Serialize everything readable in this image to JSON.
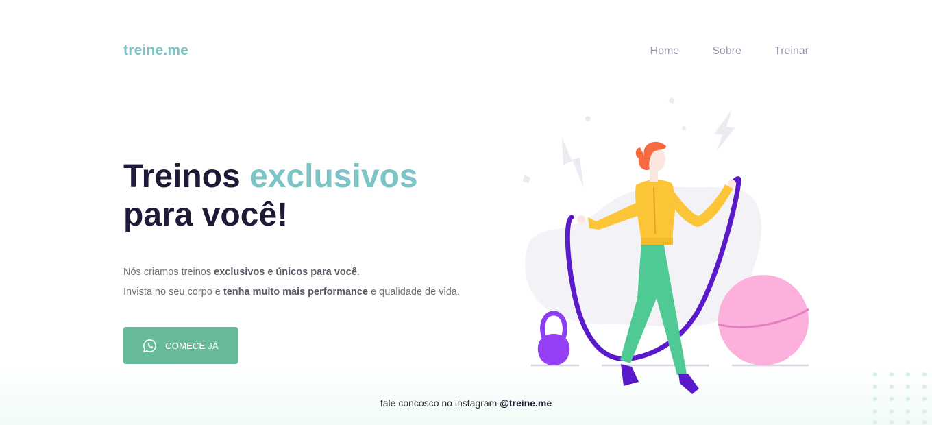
{
  "brand": {
    "logo": "treine.me"
  },
  "nav": {
    "items": [
      "Home",
      "Sobre",
      "Treinar"
    ]
  },
  "hero": {
    "title_part1": "Treinos",
    "title_accent": "exclusivos",
    "title_line2": "para você!"
  },
  "description": {
    "line1_pre": "Nós criamos treinos",
    "line1_bold": "exclusivos e únicos para você",
    "line1_post": ".",
    "line2_pre": "Invista no seu corpo e",
    "line2_bold": "tenha muito mais performance",
    "line2_post": "e qualidade de vida."
  },
  "cta": {
    "label": "COMECE JÁ",
    "icon": "whatsapp-icon"
  },
  "footer": {
    "text": "fale concosco no instagram",
    "handle": "@treine.me"
  },
  "colors": {
    "accent": "#7cc4c6",
    "cta": "#67bb9b",
    "heading": "#1e1b38"
  }
}
